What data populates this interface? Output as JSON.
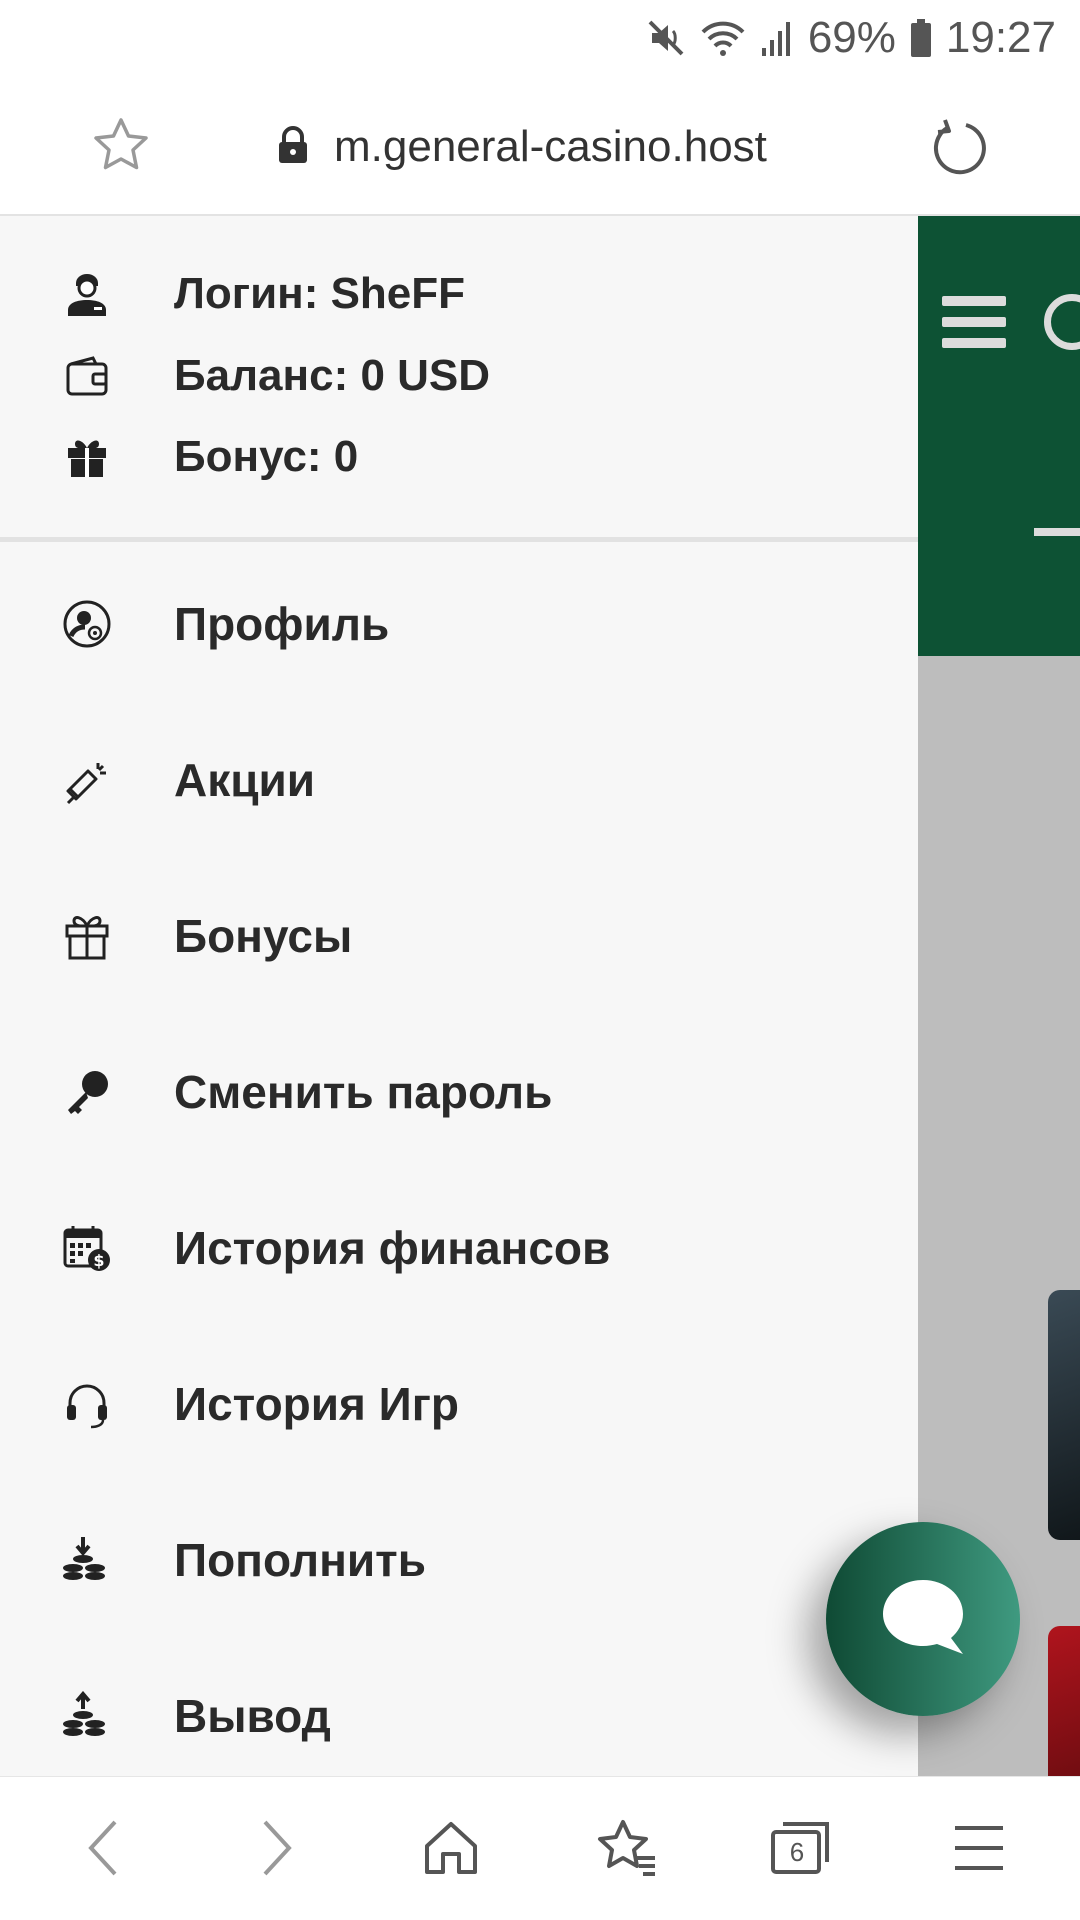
{
  "status_bar": {
    "battery_percent": "69%",
    "time": "19:27",
    "icons": [
      "mute-icon",
      "wifi-icon",
      "signal-icon",
      "battery-icon"
    ]
  },
  "url_bar": {
    "url": "m.general-casino.host",
    "icons": [
      "star-icon",
      "lock-icon",
      "reload-icon"
    ]
  },
  "account": {
    "login": "Логин: SheFF",
    "balance": "Баланс: 0 USD",
    "bonus": "Бонус: 0"
  },
  "menu": {
    "items": [
      {
        "label": "Профиль",
        "icon": "profile-icon"
      },
      {
        "label": "Акции",
        "icon": "megaphone-icon"
      },
      {
        "label": "Бонусы",
        "icon": "gift-icon"
      },
      {
        "label": "Сменить пароль",
        "icon": "key-icon"
      },
      {
        "label": "История финансов",
        "icon": "calendar-money-icon"
      },
      {
        "label": "История Игр",
        "icon": "headset-icon"
      },
      {
        "label": "Пополнить",
        "icon": "deposit-coins-icon"
      },
      {
        "label": "Вывод",
        "icon": "withdraw-coins-icon"
      }
    ]
  },
  "bottom_nav": {
    "tabs_count": "6",
    "icons": [
      "back-icon",
      "forward-icon",
      "home-icon",
      "bookmarks-icon",
      "tabs-icon",
      "menu-icon"
    ]
  },
  "colors": {
    "brand_green": "#0d5234",
    "fab_gradient_start": "#0f4a34",
    "fab_gradient_end": "#3f9a80",
    "drawer_bg": "#f7f7f7"
  }
}
